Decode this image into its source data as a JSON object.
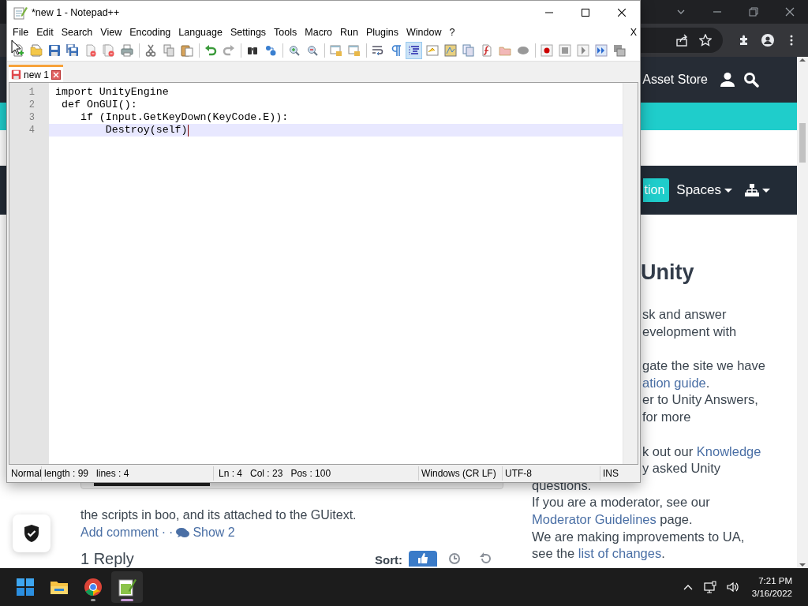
{
  "browser": {
    "window_controls": [
      {
        "kind": "tabsearch"
      },
      {
        "kind": "minimize"
      },
      {
        "kind": "restore"
      },
      {
        "kind": "close"
      }
    ],
    "toolbar": [
      {
        "kind": "share"
      },
      {
        "kind": "star"
      },
      {
        "kind": "extensions"
      },
      {
        "kind": "profile"
      },
      {
        "kind": "more"
      }
    ],
    "page": {
      "header": {
        "link": "Asset Store",
        "icons": [
          {
            "kind": "user"
          },
          {
            "kind": "search"
          }
        ]
      },
      "nav": {
        "button": "tion",
        "menus": [
          {
            "kind": "text",
            "label": "Spaces"
          },
          {
            "kind": "sitemap"
          }
        ]
      },
      "post": {
        "comment": "the scripts in boo, and its attached to the GUitext.",
        "actions": [
          {
            "kind": "link",
            "text": "Add comment"
          },
          {
            "kind": "dot",
            "text": "·"
          },
          {
            "kind": "dot",
            "text": "·"
          },
          {
            "kind": "iconlink",
            "text": "Show 2"
          }
        ],
        "replies": {
          "title": "1 Reply",
          "sort_label": "Sort:",
          "sort_buttons": [
            {
              "kind": "votes",
              "selected": true
            },
            {
              "kind": "newest",
              "selected": false
            },
            {
              "kind": "oldest",
              "selected": false
            }
          ]
        }
      },
      "sidebar": {
        "heading": "Unity",
        "paragraphs": [
          {
            "lines": [
              {
                "cut": true,
                "parts": [
                  {
                    "text": "sk and answer"
                  }
                ]
              },
              {
                "cut": true,
                "parts": [
                  {
                    "text": "evelopment with"
                  }
                ]
              }
            ]
          },
          {
            "lines": [
              {
                "cut": true,
                "parts": [
                  {
                    "text": "gate the site we have"
                  }
                ]
              },
              {
                "cut": true,
                "parts": [
                  {
                    "text": "ation guide",
                    "link": true
                  },
                  {
                    "text": "."
                  }
                ]
              },
              {
                "cut": true,
                "parts": [
                  {
                    "text": "er to Unity Answers,"
                  }
                ]
              },
              {
                "cut": true,
                "parts": [
                  {
                    "text": "for more"
                  }
                ]
              }
            ]
          },
          {
            "lines": [
              {
                "cut": true,
                "parts": [
                  {
                    "text": "k out our "
                  },
                  {
                    "text": "Knowledge",
                    "link": true
                  }
                ]
              },
              {
                "cut": true,
                "parts": [
                  {
                    "text": "y asked Unity"
                  }
                ]
              },
              {
                "cut": false,
                "parts": [
                  {
                    "text": "questions."
                  }
                ]
              },
              {
                "cut": false,
                "parts": [
                  {
                    "text": "If you are a moderator, see our"
                  }
                ]
              },
              {
                "cut": false,
                "parts": [
                  {
                    "text": "Moderator Guidelines",
                    "link": true
                  },
                  {
                    "text": " page."
                  }
                ]
              },
              {
                "cut": false,
                "parts": [
                  {
                    "text": "We are making improvements to UA,"
                  }
                ]
              },
              {
                "cut": false,
                "parts": [
                  {
                    "text": "see the "
                  },
                  {
                    "text": "list of changes",
                    "link": true
                  },
                  {
                    "text": "."
                  }
                ]
              }
            ]
          }
        ]
      }
    }
  },
  "notepad": {
    "title": "*new 1 - Notepad++",
    "menu": [
      "File",
      "Edit",
      "Search",
      "View",
      "Encoding",
      "Language",
      "Settings",
      "Tools",
      "Macro",
      "Run",
      "Plugins",
      "Window",
      "?"
    ],
    "close_document": "X",
    "toolbar": [
      [
        {
          "kind": "new",
          "selected": false
        },
        {
          "kind": "open",
          "selected": false
        },
        {
          "kind": "save",
          "selected": false
        },
        {
          "kind": "saveall",
          "selected": false
        },
        {
          "kind": "close",
          "selected": false
        },
        {
          "kind": "closeall",
          "selected": false
        },
        {
          "kind": "print",
          "selected": false
        }
      ],
      [
        {
          "kind": "cut",
          "selected": false
        },
        {
          "kind": "copy",
          "selected": false
        },
        {
          "kind": "paste",
          "selected": false
        }
      ],
      [
        {
          "kind": "undo",
          "selected": false
        },
        {
          "kind": "redo",
          "selected": false
        }
      ],
      [
        {
          "kind": "find",
          "selected": false
        },
        {
          "kind": "replace",
          "selected": false
        }
      ],
      [
        {
          "kind": "zoomin",
          "selected": false
        },
        {
          "kind": "zoomout",
          "selected": false
        }
      ],
      [
        {
          "kind": "syncv",
          "selected": false
        },
        {
          "kind": "synch",
          "selected": false
        }
      ],
      [
        {
          "kind": "wrap",
          "selected": false
        },
        {
          "kind": "allchars",
          "selected": false
        },
        {
          "kind": "indent",
          "selected": true
        },
        {
          "kind": "udl",
          "selected": false
        },
        {
          "kind": "docmap",
          "selected": false
        },
        {
          "kind": "doclist",
          "selected": false
        },
        {
          "kind": "funclist",
          "selected": false
        },
        {
          "kind": "folder",
          "selected": false
        },
        {
          "kind": "monitor",
          "selected": false
        }
      ],
      [
        {
          "kind": "record",
          "selected": false
        },
        {
          "kind": "stop",
          "selected": false
        },
        {
          "kind": "play",
          "selected": false
        },
        {
          "kind": "runmulti",
          "selected": false
        },
        {
          "kind": "savemacro",
          "selected": false
        }
      ]
    ],
    "tabs": [
      {
        "label": "new 1",
        "selected": true,
        "modified": true
      }
    ],
    "lines": [
      {
        "number": "1",
        "text": "import UnityEngine",
        "current": false
      },
      {
        "number": "2",
        "text": " def OnGUI():",
        "current": false
      },
      {
        "number": "3",
        "text": "    if (Input.GetKeyDown(KeyCode.E)):",
        "current": false
      },
      {
        "number": "4",
        "text": "        Destroy(self)",
        "current": true
      }
    ],
    "status_bar": [
      {
        "items": [
          "Normal"
        ]
      },
      {
        "items": [
          "length : 99",
          "lines : 4"
        ]
      },
      {
        "items": [
          "Ln : 4",
          "Col : 23",
          "Pos : 100"
        ]
      },
      {
        "items": [
          "Windows (CR LF)"
        ]
      },
      {
        "items": [
          "UTF-8"
        ]
      },
      {
        "items": [
          "INS"
        ]
      }
    ]
  },
  "mouse_pointer": {
    "kind": "arrow"
  },
  "taskbar": {
    "apps": [
      {
        "kind": "start",
        "open": false,
        "selected": false
      },
      {
        "kind": "explorer",
        "open": false,
        "selected": false
      },
      {
        "kind": "browser",
        "open": true,
        "selected": false
      },
      {
        "kind": "notepad",
        "open": true,
        "selected": true
      }
    ],
    "tray": [
      {
        "kind": "chevron"
      },
      {
        "kind": "network"
      },
      {
        "kind": "volume"
      }
    ],
    "clock": {
      "time": "7:21 PM",
      "date": "3/16/2022"
    }
  }
}
